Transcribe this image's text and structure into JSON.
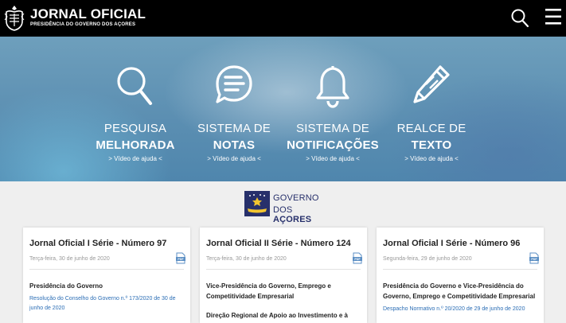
{
  "header": {
    "title": "JORNAL OFICIAL",
    "subtitle": "PRESIDÊNCIA DO GOVERNO DOS AÇORES",
    "search_icon": "search-icon",
    "menu_icon": "hamburger-menu-icon"
  },
  "features": [
    {
      "line1": "PESQUISA",
      "line2": "MELHORADA",
      "help": "> Vídeo de ajuda <",
      "icon": "magnifier-icon"
    },
    {
      "line1": "SISTEMA DE",
      "line2": "NOTAS",
      "help": "> Vídeo de ajuda <",
      "icon": "chat-bubble-icon"
    },
    {
      "line1": "SISTEMA DE",
      "line2": "NOTIFICAÇÕES",
      "help": "> Vídeo de ajuda <",
      "icon": "bell-icon"
    },
    {
      "line1": "REALCE DE",
      "line2": "TEXTO",
      "help": "> Vídeo de ajuda <",
      "icon": "pencil-icon"
    }
  ],
  "gov_logo": {
    "line1": "GOVERNO",
    "line2a": "DOS ",
    "line2b": "AÇORES"
  },
  "cards": [
    {
      "title": "Jornal Oficial I Série - Número 97",
      "date": "Terça-feira, 30 de junho de 2020",
      "org": "Presidência do Governo",
      "link": "Resolução do Conselho do Governo n.º 173/2020 de 30 de junho de 2020"
    },
    {
      "title": "Jornal Oficial II Série - Número 124",
      "date": "Terça-feira, 30 de junho de 2020",
      "org": "Vice-Presidência do Governo, Emprego e Competitividade Empresarial",
      "org2": "Direção Regional de Apoio ao Investimento e à"
    },
    {
      "title": "Jornal Oficial I Série - Número 96",
      "date": "Segunda-feira, 29 de junho de 2020",
      "org": "Presidência do Governo e Vice-Presidência do Governo, Emprego e Competitividade Empresarial",
      "link": "Despacho Normativo n.º 20/2020 de 29 de junho de 2020"
    }
  ],
  "colors": {
    "header_bg": "#000000",
    "link": "#2a6db5",
    "gov_blue": "#27306b"
  }
}
